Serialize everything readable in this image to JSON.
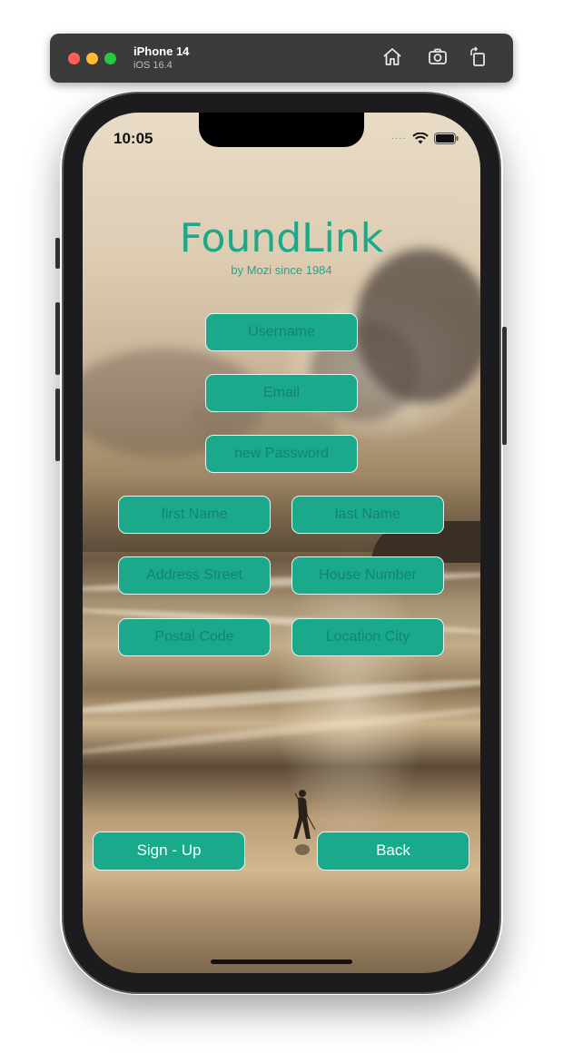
{
  "simulator": {
    "device_name": "iPhone 14",
    "os_version": "iOS 16.4",
    "icons": [
      "home-icon",
      "screenshot-icon",
      "rotate-icon"
    ]
  },
  "status_bar": {
    "time": "10:05",
    "icons": [
      "cellular-dots-icon",
      "wifi-icon",
      "battery-icon"
    ]
  },
  "app": {
    "title": "FoundLink",
    "subtitle": "by Mozi since 1984",
    "accent_color": "#1aa98a"
  },
  "form": {
    "username_placeholder": "Username",
    "email_placeholder": "Email",
    "password_placeholder": "new Password",
    "first_name_placeholder": "first Name",
    "last_name_placeholder": "last Name",
    "street_placeholder": "Address Street",
    "house_number_placeholder": "House Number",
    "postal_code_placeholder": "Postal Code",
    "city_placeholder": "Location City"
  },
  "buttons": {
    "signup_label": "Sign - Up",
    "back_label": "Back"
  }
}
